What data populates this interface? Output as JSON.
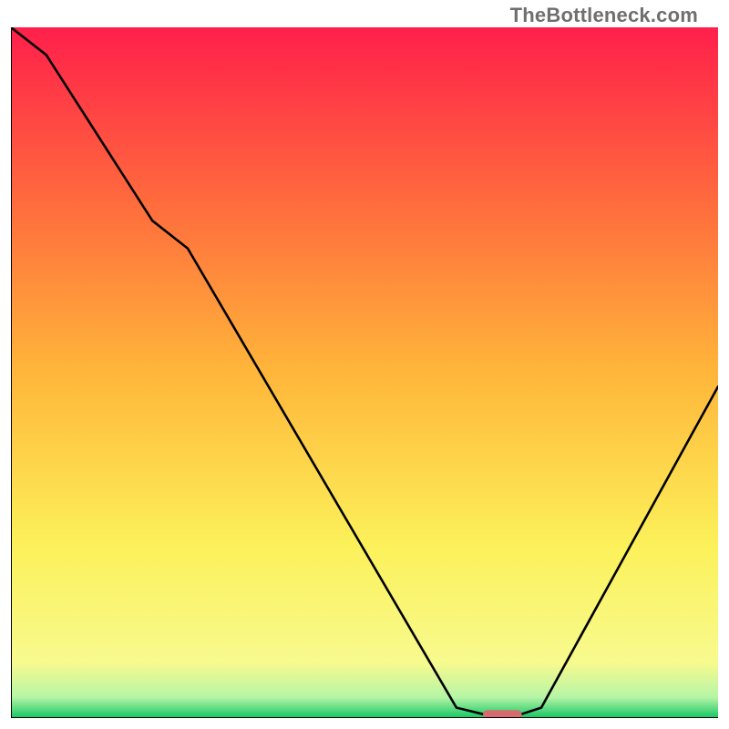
{
  "watermark": {
    "text": "TheBottleneck.com"
  },
  "chart_data": {
    "type": "line",
    "title": "",
    "xlabel": "",
    "ylabel": "",
    "xlim": [
      0,
      100
    ],
    "ylim": [
      0,
      100
    ],
    "grid": false,
    "legend": false,
    "series": [
      {
        "name": "bottleneck-curve",
        "x": [
          0,
          5,
          20,
          25,
          63,
          67,
          72,
          75,
          100
        ],
        "values": [
          100,
          96,
          72,
          68,
          1.5,
          0.5,
          0.5,
          1.5,
          48
        ]
      }
    ],
    "marker": {
      "name": "highlight-segment",
      "x_start": 67,
      "x_end": 72,
      "y": 0.5,
      "color": "#d46b6e"
    },
    "background_gradient": {
      "stops": [
        {
          "y": 100,
          "color": "#ff1f4b"
        },
        {
          "y": 75,
          "color": "#ff6a3d"
        },
        {
          "y": 50,
          "color": "#ffb63a"
        },
        {
          "y": 25,
          "color": "#fcf15a"
        },
        {
          "y": 8,
          "color": "#f7fa8e"
        },
        {
          "y": 2,
          "color": "#b6f5a6"
        },
        {
          "y": 0,
          "color": "#13c764"
        }
      ]
    }
  }
}
